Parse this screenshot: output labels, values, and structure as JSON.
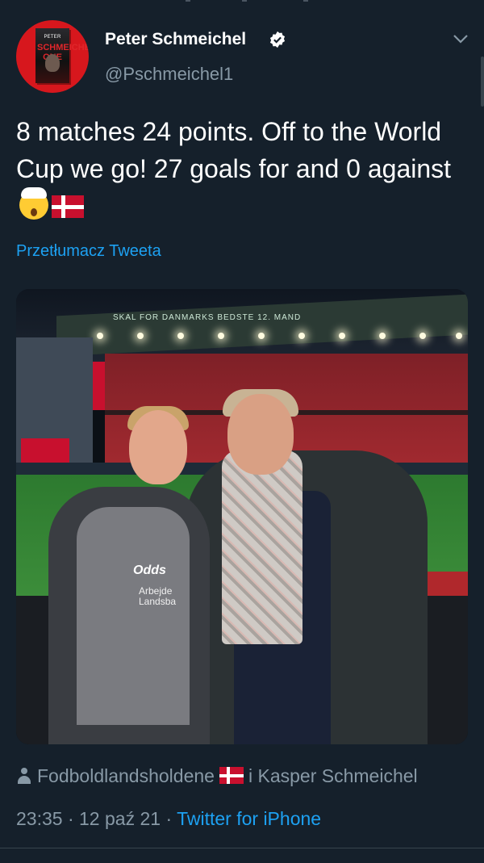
{
  "author": {
    "name": "Peter Schmeichel",
    "handle": "@Pschmeichel1",
    "avatar_book_small": "PETER",
    "avatar_book_title": "SCHMEICHEL ONE"
  },
  "tweet": {
    "text": "8 matches 24 points. Off to the World Cup we go! 27 goals for and 0 against",
    "emojis": [
      "exploding-head-icon",
      "denmark-flag-icon"
    ],
    "translate_label": "Przetłumacz Tweeta"
  },
  "photo": {
    "banner_text": "SKAL FOR DANMARKS BEDSTE 12. MAND",
    "sponsor_text": "Odds",
    "sponsor_sub": "Arbejde\nLandsba"
  },
  "location": {
    "account": "Fodboldlandsholdene",
    "connector": "i",
    "tagged": "Kasper Schmeichel"
  },
  "meta": {
    "time": "23:35",
    "separator": "·",
    "date": "12 paź 21",
    "app": "Twitter for iPhone"
  },
  "colors": {
    "background": "#15202b",
    "link": "#1da1f2",
    "secondary_text": "#8899a6",
    "avatar_bg": "#d7171d"
  }
}
